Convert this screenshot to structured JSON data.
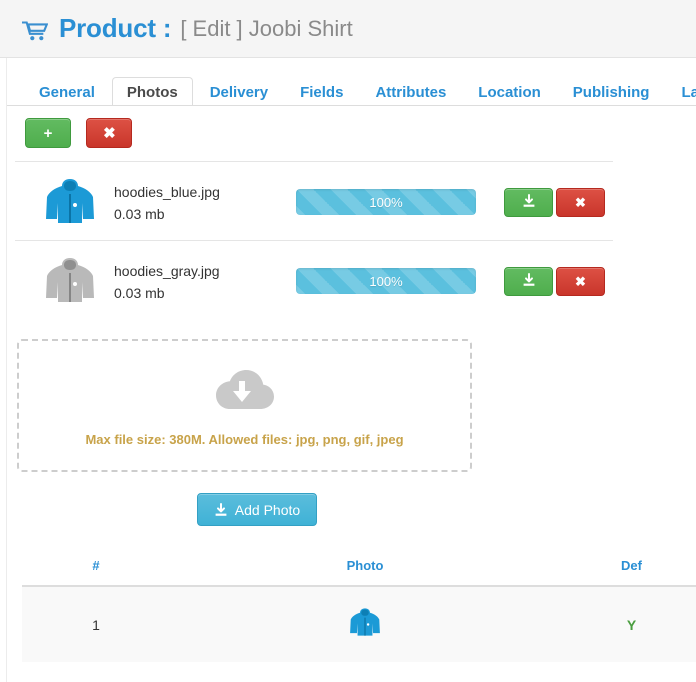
{
  "header": {
    "icon": "shopping-cart-icon",
    "title": "Product :",
    "subtitle": "[ Edit ] Joobi Shirt"
  },
  "tabs": [
    {
      "label": "General",
      "active": false
    },
    {
      "label": "Photos",
      "active": true
    },
    {
      "label": "Delivery",
      "active": false
    },
    {
      "label": "Fields",
      "active": false
    },
    {
      "label": "Attributes",
      "active": false
    },
    {
      "label": "Location",
      "active": false
    },
    {
      "label": "Publishing",
      "active": false
    },
    {
      "label": "Layo",
      "active": false
    }
  ],
  "toolbar": {
    "add_label": "+",
    "add_icon": "plus-icon",
    "delete_label": "✖",
    "delete_icon": "cross-icon"
  },
  "files": [
    {
      "thumb": "blue-hoodie-thumbnail",
      "name": "hoodies_blue.jpg",
      "size": "0.03 mb",
      "progress": "100%",
      "progress_value": 100,
      "download_icon": "download-icon",
      "remove_icon": "cross-icon"
    },
    {
      "thumb": "gray-hoodie-thumbnail",
      "name": "hoodies_gray.jpg",
      "size": "0.03 mb",
      "progress": "100%",
      "progress_value": 100,
      "download_icon": "download-icon",
      "remove_icon": "cross-icon"
    }
  ],
  "dropzone": {
    "icon": "cloud-download-icon",
    "text": "Max file size: 380M. Allowed files: jpg, png, gif, jpeg"
  },
  "add_photo": {
    "icon": "download-icon",
    "label": "Add Photo"
  },
  "photo_table": {
    "columns": [
      "#",
      "Photo",
      "Def"
    ],
    "rows": [
      {
        "num": "1",
        "photo": "blue-hoodie-thumbnail",
        "default": "Y"
      }
    ]
  },
  "colors": {
    "accent_blue": "#2a8fd4",
    "progress_blue": "#5bc0de",
    "green": "#4fae4d",
    "red": "#c9362b",
    "dropzone_text": "#c8a34a",
    "header_bg": "#f5f5f5"
  }
}
